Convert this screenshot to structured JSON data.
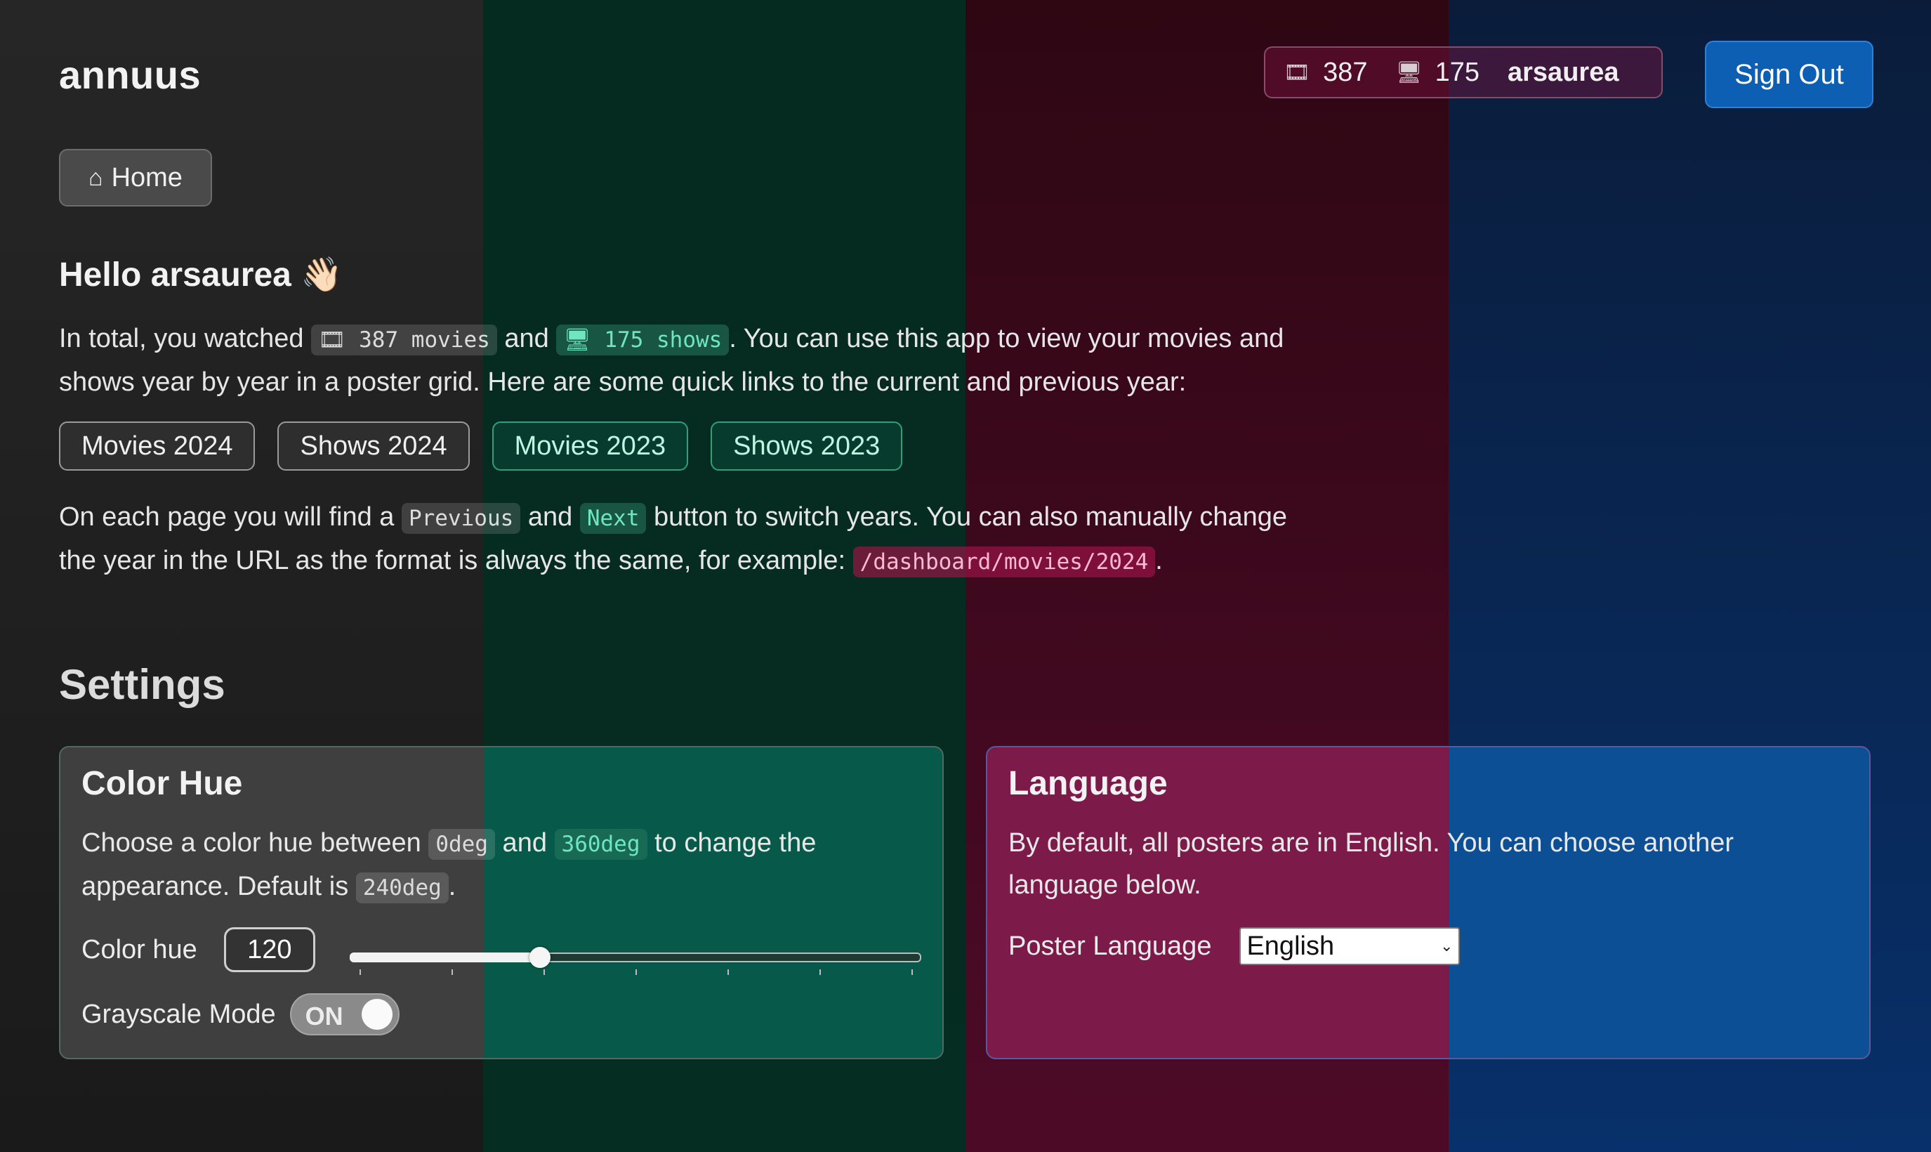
{
  "app": {
    "brand": "annuus"
  },
  "header": {
    "movies_count": "387",
    "shows_count": "175",
    "username": "arsaurea",
    "signout_label": "Sign Out",
    "movies_icon": "film-icon",
    "shows_icon": "monitor-icon"
  },
  "nav": {
    "home_label": "Home",
    "home_icon": "home-icon"
  },
  "intro": {
    "greeting": "Hello arsaurea",
    "greeting_emoji": "👋🏻",
    "p1_a": "In total, you watched ",
    "movies_chip": "387 movies",
    "p1_b": " and ",
    "shows_chip": "175 shows",
    "p1_c": ". You can use this app to view your movies and shows year by year in a poster grid. Here are some quick links to the current and previous year:",
    "quick_links": [
      "Movies 2024",
      "Shows 2024",
      "Movies 2023",
      "Shows 2023"
    ],
    "p2_a": "On each page you will find a ",
    "prev_chip": "Previous",
    "p2_b": " and ",
    "next_chip": "Next",
    "p2_c": " button to switch years. You can also manually change the year in the URL as the format is always the same, for example: ",
    "url_chip": "/dashboard/movies/2024",
    "p2_d": "."
  },
  "settings": {
    "title": "Settings",
    "color_hue": {
      "title": "Color Hue",
      "desc_a": "Choose a color hue between ",
      "min_chip": "0deg",
      "desc_b": " and ",
      "max_chip": "360deg",
      "desc_c": " to change the appearance. Default is ",
      "default_chip": "240deg",
      "desc_d": ".",
      "label": "Color hue",
      "value": "120",
      "slider_min": 0,
      "slider_max": 360,
      "slider_value": 120,
      "grayscale_label": "Grayscale Mode",
      "grayscale_state": "ON"
    },
    "language": {
      "title": "Language",
      "desc": "By default, all posters are in English. You can choose another language below.",
      "label": "Poster Language",
      "selected": "English"
    }
  },
  "colors": {
    "band_dark": "#262626",
    "band_green": "#052a20",
    "band_maroon": "#3a0820",
    "band_blue": "#0a2452",
    "accent_blue": "#0d5fb3",
    "chip_green": "#6fe6c0",
    "chip_pink": "#ffb9d3"
  }
}
